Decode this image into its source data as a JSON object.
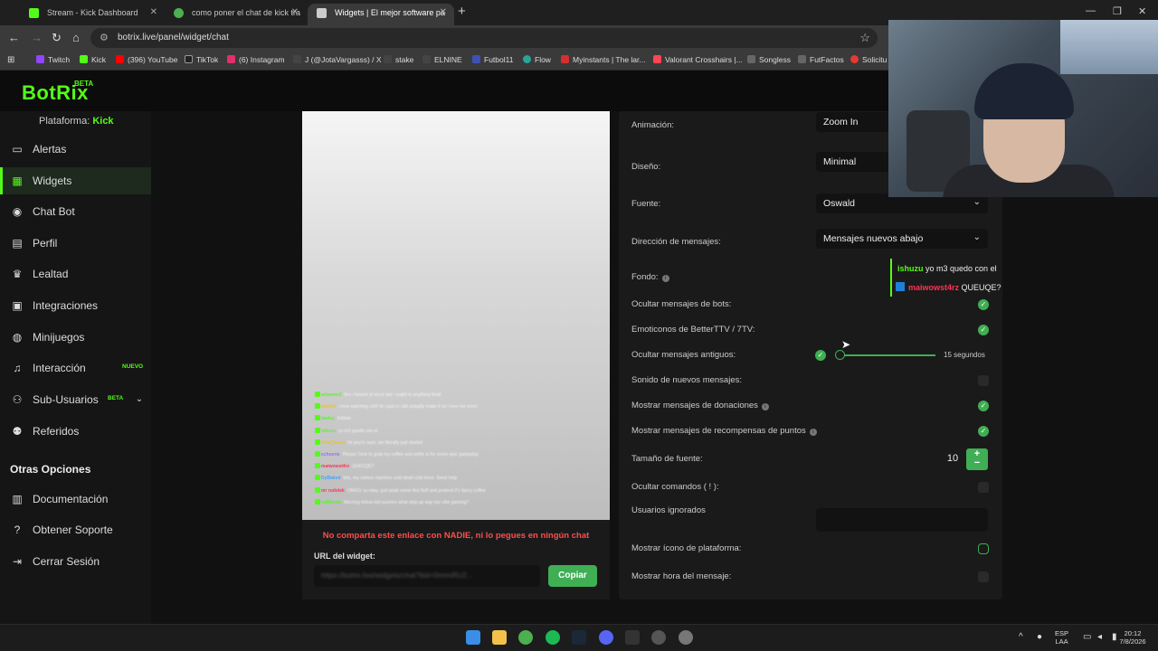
{
  "browser": {
    "tabs": [
      {
        "title": "Stream - Kick Dashboard",
        "color": "#53fc18"
      },
      {
        "title": "como poner el chat de kick tra",
        "color": "#4caf50"
      },
      {
        "title": "Widgets | El mejor software pa",
        "color": "#cccccc"
      }
    ],
    "url": "botrix.live/panel/widget/chat",
    "bookmarks": [
      {
        "label": "Twitch",
        "color": "#9146ff"
      },
      {
        "label": "Kick",
        "color": "#53fc18"
      },
      {
        "label": "(396) YouTube",
        "color": "#ff0000"
      },
      {
        "label": "TikTok",
        "color": "#222222"
      },
      {
        "label": "(6) Instagram",
        "color": "#e1306c"
      },
      {
        "label": "J (@JotaVargasss) / X",
        "color": "#444444"
      },
      {
        "label": "stake",
        "color": "#444444"
      },
      {
        "label": "ELNINE",
        "color": "#444444"
      },
      {
        "label": "Futbol11",
        "color": "#3f51b5"
      },
      {
        "label": "Flow",
        "color": "#26a69a"
      },
      {
        "label": "Myinstants | The lar...",
        "color": "#d32f2f"
      },
      {
        "label": "Valorant Crosshairs |...",
        "color": "#ff4655"
      },
      {
        "label": "Songless",
        "color": "#666666"
      },
      {
        "label": "FutFactos",
        "color": "#666666"
      },
      {
        "label": "Solicitu",
        "color": "#e53935"
      }
    ]
  },
  "app": {
    "logo": "BotRix",
    "logo_badge": "BETA",
    "platform_label": "Plataforma:",
    "platform_value": "Kick"
  },
  "sidebar": {
    "items": [
      {
        "label": "Alertas",
        "icon": "monitor-icon"
      },
      {
        "label": "Widgets",
        "icon": "grid-icon"
      },
      {
        "label": "Chat Bot",
        "icon": "robot-icon"
      },
      {
        "label": "Perfil",
        "icon": "id-card-icon"
      },
      {
        "label": "Lealtad",
        "icon": "trophy-icon"
      },
      {
        "label": "Integraciones",
        "icon": "plug-icon"
      },
      {
        "label": "Minijuegos",
        "icon": "gamepad-icon"
      },
      {
        "label": "Interacción",
        "icon": "music-icon",
        "tag": "NUEVO"
      },
      {
        "label": "Sub-Usuarios",
        "icon": "users-icon",
        "tag": "BETA"
      },
      {
        "label": "Referidos",
        "icon": "referral-icon"
      }
    ],
    "others_title": "Otras Opciones",
    "others": [
      {
        "label": "Documentación",
        "icon": "document-icon"
      },
      {
        "label": "Obtener Soporte",
        "icon": "help-icon"
      },
      {
        "label": "Cerrar Sesión",
        "icon": "logout-icon"
      }
    ]
  },
  "preview": {
    "chat_lines": [
      {
        "user": "artsomn2",
        "color": "#53fc18",
        "text": "bro i havent yt since bat i ought to anything finall"
      },
      {
        "user": "elspirit",
        "color": "#f0c419",
        "text": "i love watching ch9! its i just a i did actually make it so i love me more"
      },
      {
        "user": "harley",
        "color": "#53fc18",
        "text": "holaaa"
      },
      {
        "user": "ishuzu",
        "color": "#53fc18",
        "text": "yo m3 quedo con el"
      },
      {
        "user": "RealQueen",
        "color": "#f0c419",
        "text": "lol you're sure. we literally just started"
      },
      {
        "user": "echoerie",
        "color": "#a06bff",
        "text": "Please Time to grab my coffee and settle in for some epic gameplay"
      },
      {
        "user": "maiwowst4rz",
        "color": "#ff3355",
        "text": "QUEUQE?"
      },
      {
        "user": "DyBaked",
        "color": "#3ea6ff",
        "text": "lets, my carbon machine sold dead cold force. Send help"
      },
      {
        "user": "mr rudolek",
        "color": "#ff3355",
        "text": "OMGG so easy. just peak some fled fluff and pretend it's fancy coffee"
      },
      {
        "user": "lolMunda",
        "color": "#53fc18",
        "text": "Morning fellow kid sunnies what step up way too vibe gaming?"
      }
    ],
    "warning": "No comparta este enlace con NADIE, ni lo pegues en ningún chat",
    "url_label": "URL del widget:",
    "url_value": "https://botrix.live/widgets/chat?bid=0rmmRU2...",
    "copy_label": "Copiar"
  },
  "settings": {
    "animacion_label": "Animación:",
    "animacion_value": "Zoom In",
    "diseno_label": "Diseño:",
    "diseno_value": "Minimal",
    "fuente_label": "Fuente:",
    "fuente_value": "Oswald",
    "direccion_label": "Dirección de mensajes:",
    "direccion_value": "Mensajes nuevos abajo",
    "fondo_label": "Fondo:",
    "fondo_preview_user1": "ishuzu",
    "fondo_preview_text1": "yo m3 quedo con el",
    "fondo_preview_user2": "maiwowst4rz",
    "fondo_preview_text2": "QUEUQE?",
    "bots_label": "Ocultar mensajes de bots:",
    "bttv_label": "Emoticonos de BetterTTV / 7TV:",
    "antiguos_label": "Ocultar mensajes antiguos:",
    "antiguos_seconds": "15 segundos",
    "slider_fraction": 0.0,
    "sonido_label": "Sonido de nuevos mensajes:",
    "donaciones_label": "Mostrar mensajes de donaciones",
    "recompensas_label": "Mostrar mensajes de recompensas de puntos",
    "tamano_label": "Tamaño de fuente:",
    "tamano_value": "10",
    "comandos_label": "Ocultar comandos ( ! ):",
    "ignorados_label": "Usuarios ignorados",
    "plataforma_icon_label": "Mostrar ícono de plataforma:",
    "hora_label": "Mostrar hora del mensaje:"
  },
  "taskbar": {
    "lang1": "ESP",
    "lang2": "LAA",
    "time": "20:12",
    "date": "7/8/2026"
  }
}
